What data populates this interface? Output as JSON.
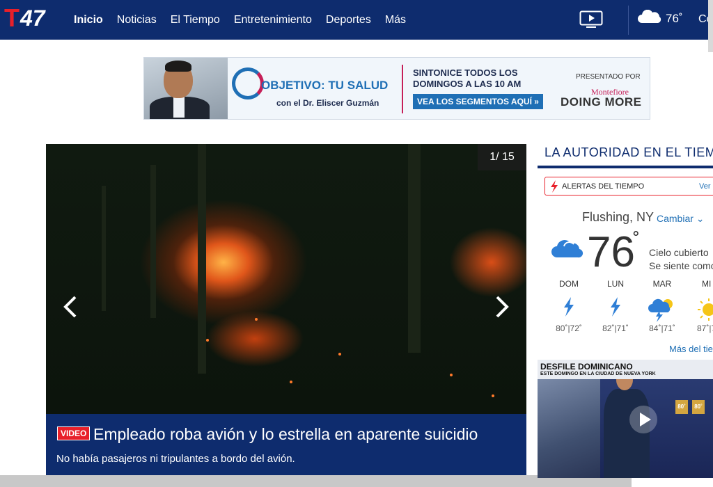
{
  "header": {
    "logo_letter": "T",
    "logo_number": "47",
    "nav": [
      {
        "label": "Inicio",
        "active": true
      },
      {
        "label": "Noticias",
        "active": false
      },
      {
        "label": "El Tiempo",
        "active": false
      },
      {
        "label": "Entretenimiento",
        "active": false
      },
      {
        "label": "Deportes",
        "active": false
      },
      {
        "label": "Más",
        "active": false
      }
    ],
    "tv_icon": "tv-play-icon",
    "weather_icon": "cloud-icon",
    "temperature": "76˚",
    "right_text": "Co"
  },
  "ad": {
    "title": "OBJETIVO: TU SALUD",
    "subtitle": "con el  Dr. Eliscer Guzmán",
    "cta": "SINTONICE TODOS LOS DOMINGOS A LAS 10 AM",
    "button": "VEA LOS SEGMENTOS AQUÍ »",
    "presented_by": "PRESENTADO POR",
    "sponsor_top": "Montefiore",
    "sponsor_main": "DOING MORE"
  },
  "hero": {
    "counter": "1/ 15",
    "badge": "VIDEO",
    "title": "Empleado roba avión y lo estrella en aparente suicidio",
    "subtitle": "No había pasajeros ni tripulantes a bordo del avión.",
    "prev_icon": "chevron-left-icon",
    "next_icon": "chevron-right-icon"
  },
  "weather": {
    "section_title": "LA AUTORIDAD EN EL TIEM",
    "alert_label": "ALERTAS DEL TIEMPO",
    "alert_link": "Ver",
    "location": "Flushing, NY",
    "change_label": "Cambiar",
    "current_temp": "76",
    "degree": "˚",
    "condition": "Cielo cubierto",
    "feels_like": "Se siente como",
    "forecast": [
      {
        "day": "DOM",
        "icon": "lightning-icon",
        "temps": "80˚|72˚"
      },
      {
        "day": "LUN",
        "icon": "lightning-icon",
        "temps": "82˚|71˚"
      },
      {
        "day": "MAR",
        "icon": "storm-cloud-sun-icon",
        "temps": "84˚|71˚"
      },
      {
        "day": "MI",
        "icon": "sun-icon",
        "temps": "87˚|7"
      }
    ],
    "more_link": "Más del tiem",
    "promo_title": "DESFILE DOMINICANO",
    "promo_subtitle": "ESTE DOMINGO EN LA CIUDAD DE NUEVA YORK",
    "promo_tiles": [
      "80˚",
      "80˚"
    ],
    "colors": {
      "navy": "#0e2c6e",
      "red": "#e8202a",
      "link": "#1f6fb5"
    }
  }
}
